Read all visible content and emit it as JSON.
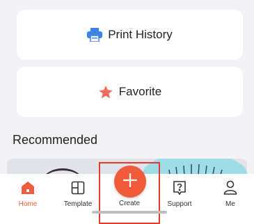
{
  "cards": {
    "print_history": "Print History",
    "favorite": "Favorite"
  },
  "section": {
    "recommended": "Recommended"
  },
  "tabs": {
    "home": "Home",
    "template": "Template",
    "create": "Create",
    "support": "Support",
    "me": "Me"
  },
  "colors": {
    "accent": "#ef5b3b",
    "highlight_border": "#e23a2b",
    "printer_blue": "#3d84e6",
    "star": "#f06a5e"
  }
}
